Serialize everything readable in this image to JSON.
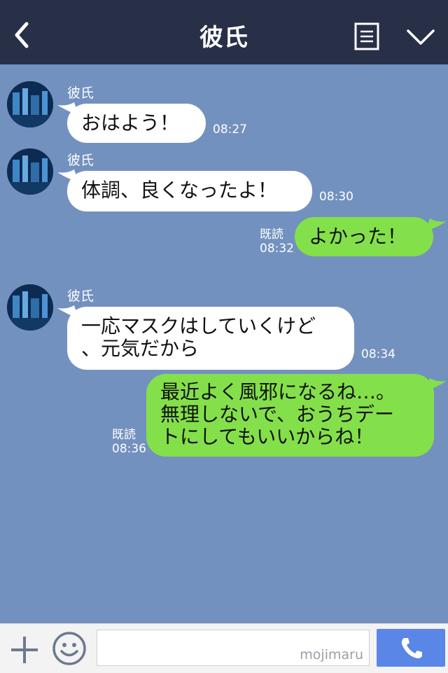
{
  "header": {
    "title": "彼氏",
    "back_icon": "chevron-left-icon",
    "menu_icon": "menu-icon",
    "collapse_icon": "chevron-down-icon",
    "background": "#283048"
  },
  "chat": {
    "background": "#7391bf",
    "messages": [
      {
        "from": "彼氏",
        "text": "おはよう！",
        "time": "08:27"
      },
      {
        "from": "彼氏",
        "text": "体調、良くなったよ！",
        "time": "08:30"
      },
      {
        "from": "me",
        "text": "よかった！",
        "read": "既読",
        "time": "08:32"
      },
      {
        "from": "彼氏",
        "text_line1": "一応マスクはしていくけど",
        "text_line2": "、元気だから",
        "time": "08:34"
      },
      {
        "from": "me",
        "text_line1": "最近よく風邪になるね…。",
        "text_line2": "無理しないで、おうちデー",
        "text_line3": "トにしてもいいからね！",
        "read": "既読",
        "time": "08:36"
      }
    ]
  },
  "bottom_bar": {
    "plus_icon": "plus-icon",
    "emoji_icon": "smiley-icon",
    "input_value": "",
    "watermark": "mojimaru",
    "call_icon": "phone-icon",
    "accent": "#5a86e8"
  }
}
